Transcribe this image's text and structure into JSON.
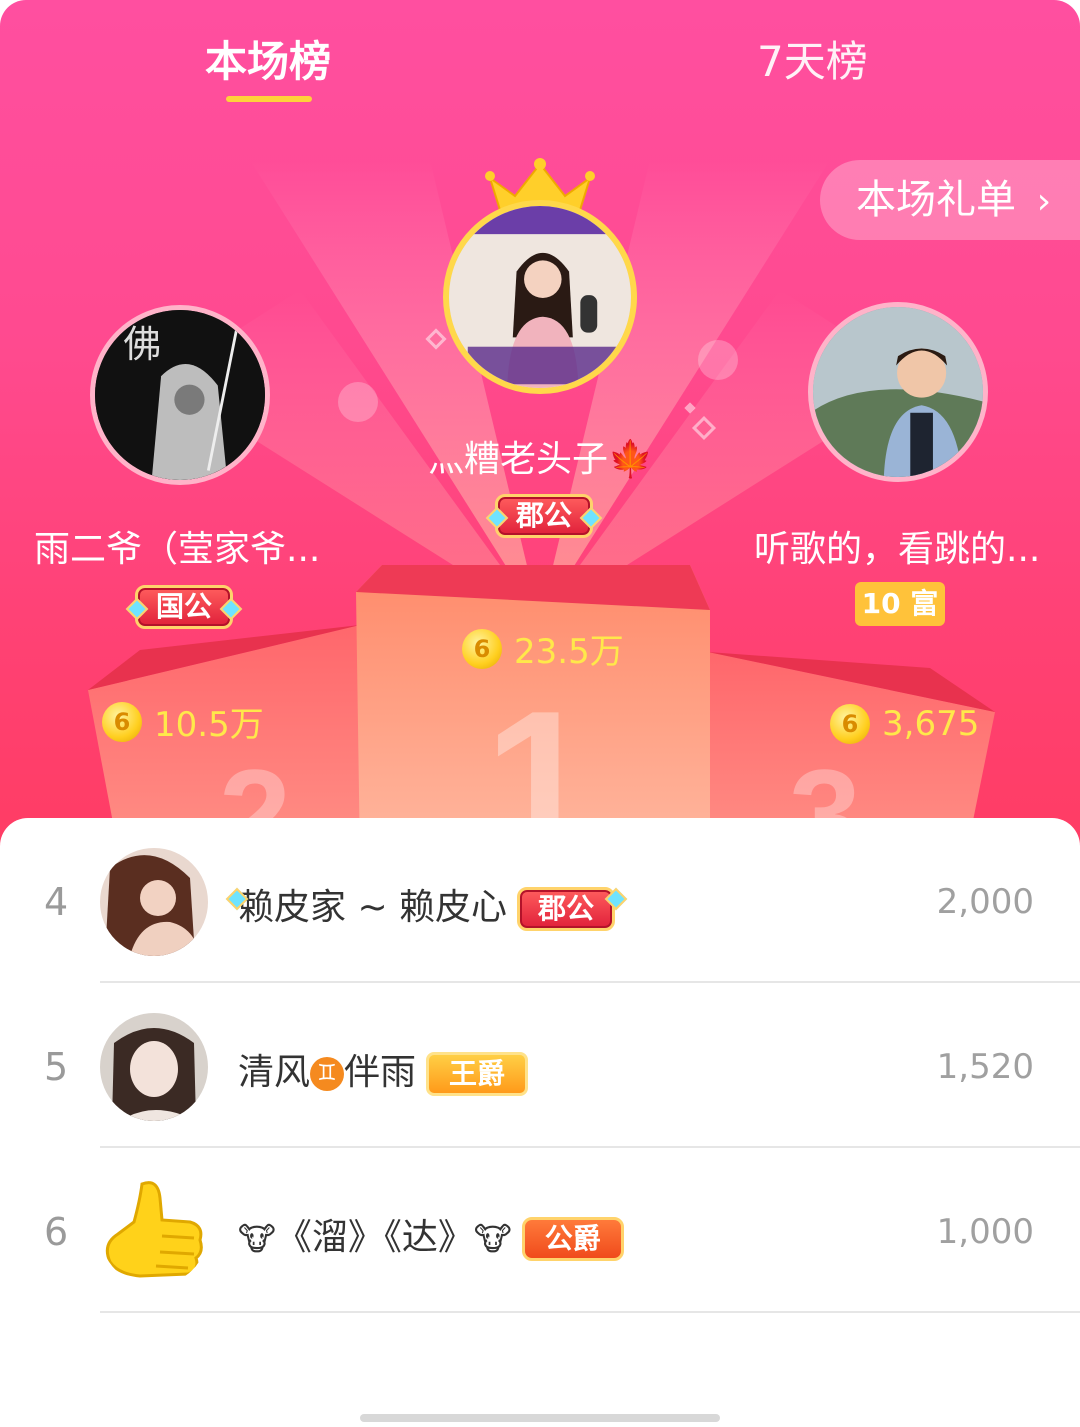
{
  "tabs": {
    "current": "本场榜",
    "seven_day": "7天榜"
  },
  "gift_list_button": {
    "label": "本场礼单",
    "chevron": "›"
  },
  "podium": {
    "first": {
      "name": "灬糟老头子🍁",
      "badge": "郡公",
      "score": "23.5万",
      "coin_glyph": "6"
    },
    "second": {
      "name": "雨二爷（莹家爷...",
      "badge": "国公",
      "score": "10.5万",
      "coin_glyph": "6"
    },
    "third": {
      "name": "听歌的，看跳的...",
      "badge": "10 富",
      "score": "3,675",
      "coin_glyph": "6"
    }
  },
  "list": [
    {
      "rank": "4",
      "name": "赖皮家 ~ 赖皮心",
      "badge": "郡公",
      "score": "2,000"
    },
    {
      "rank": "5",
      "name_a": "清风",
      "gem": "♊",
      "name_b": "伴雨",
      "badge": "王爵",
      "score": "1,520"
    },
    {
      "rank": "6",
      "cow": "🐮",
      "name": "《溜》《达》",
      "badge": "公爵",
      "score": "1,000"
    }
  ],
  "colors": {
    "accent_pink": "#ff4a8f",
    "gold": "#ffd23a",
    "score_yellow": "#ffe84a"
  }
}
